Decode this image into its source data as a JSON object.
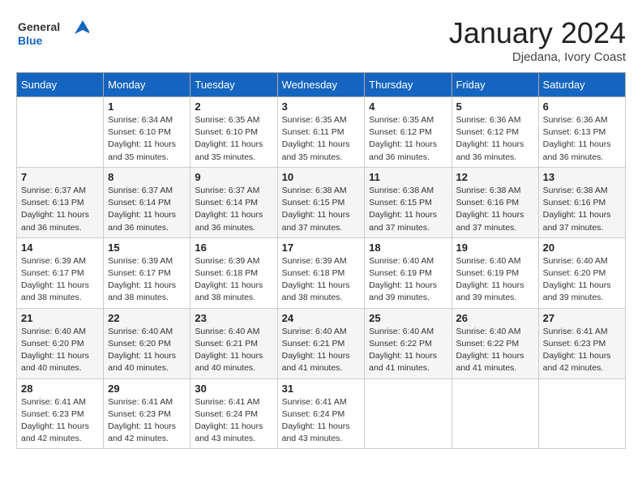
{
  "header": {
    "logo_general": "General",
    "logo_blue": "Blue",
    "month_year": "January 2024",
    "location": "Djedana, Ivory Coast"
  },
  "weekdays": [
    "Sunday",
    "Monday",
    "Tuesday",
    "Wednesday",
    "Thursday",
    "Friday",
    "Saturday"
  ],
  "weeks": [
    [
      {
        "day": "",
        "sunrise": "",
        "sunset": "",
        "daylight": ""
      },
      {
        "day": "1",
        "sunrise": "Sunrise: 6:34 AM",
        "sunset": "Sunset: 6:10 PM",
        "daylight": "Daylight: 11 hours and 35 minutes."
      },
      {
        "day": "2",
        "sunrise": "Sunrise: 6:35 AM",
        "sunset": "Sunset: 6:10 PM",
        "daylight": "Daylight: 11 hours and 35 minutes."
      },
      {
        "day": "3",
        "sunrise": "Sunrise: 6:35 AM",
        "sunset": "Sunset: 6:11 PM",
        "daylight": "Daylight: 11 hours and 35 minutes."
      },
      {
        "day": "4",
        "sunrise": "Sunrise: 6:35 AM",
        "sunset": "Sunset: 6:12 PM",
        "daylight": "Daylight: 11 hours and 36 minutes."
      },
      {
        "day": "5",
        "sunrise": "Sunrise: 6:36 AM",
        "sunset": "Sunset: 6:12 PM",
        "daylight": "Daylight: 11 hours and 36 minutes."
      },
      {
        "day": "6",
        "sunrise": "Sunrise: 6:36 AM",
        "sunset": "Sunset: 6:13 PM",
        "daylight": "Daylight: 11 hours and 36 minutes."
      }
    ],
    [
      {
        "day": "7",
        "sunrise": "Sunrise: 6:37 AM",
        "sunset": "Sunset: 6:13 PM",
        "daylight": "Daylight: 11 hours and 36 minutes."
      },
      {
        "day": "8",
        "sunrise": "Sunrise: 6:37 AM",
        "sunset": "Sunset: 6:14 PM",
        "daylight": "Daylight: 11 hours and 36 minutes."
      },
      {
        "day": "9",
        "sunrise": "Sunrise: 6:37 AM",
        "sunset": "Sunset: 6:14 PM",
        "daylight": "Daylight: 11 hours and 36 minutes."
      },
      {
        "day": "10",
        "sunrise": "Sunrise: 6:38 AM",
        "sunset": "Sunset: 6:15 PM",
        "daylight": "Daylight: 11 hours and 37 minutes."
      },
      {
        "day": "11",
        "sunrise": "Sunrise: 6:38 AM",
        "sunset": "Sunset: 6:15 PM",
        "daylight": "Daylight: 11 hours and 37 minutes."
      },
      {
        "day": "12",
        "sunrise": "Sunrise: 6:38 AM",
        "sunset": "Sunset: 6:16 PM",
        "daylight": "Daylight: 11 hours and 37 minutes."
      },
      {
        "day": "13",
        "sunrise": "Sunrise: 6:38 AM",
        "sunset": "Sunset: 6:16 PM",
        "daylight": "Daylight: 11 hours and 37 minutes."
      }
    ],
    [
      {
        "day": "14",
        "sunrise": "Sunrise: 6:39 AM",
        "sunset": "Sunset: 6:17 PM",
        "daylight": "Daylight: 11 hours and 38 minutes."
      },
      {
        "day": "15",
        "sunrise": "Sunrise: 6:39 AM",
        "sunset": "Sunset: 6:17 PM",
        "daylight": "Daylight: 11 hours and 38 minutes."
      },
      {
        "day": "16",
        "sunrise": "Sunrise: 6:39 AM",
        "sunset": "Sunset: 6:18 PM",
        "daylight": "Daylight: 11 hours and 38 minutes."
      },
      {
        "day": "17",
        "sunrise": "Sunrise: 6:39 AM",
        "sunset": "Sunset: 6:18 PM",
        "daylight": "Daylight: 11 hours and 38 minutes."
      },
      {
        "day": "18",
        "sunrise": "Sunrise: 6:40 AM",
        "sunset": "Sunset: 6:19 PM",
        "daylight": "Daylight: 11 hours and 39 minutes."
      },
      {
        "day": "19",
        "sunrise": "Sunrise: 6:40 AM",
        "sunset": "Sunset: 6:19 PM",
        "daylight": "Daylight: 11 hours and 39 minutes."
      },
      {
        "day": "20",
        "sunrise": "Sunrise: 6:40 AM",
        "sunset": "Sunset: 6:20 PM",
        "daylight": "Daylight: 11 hours and 39 minutes."
      }
    ],
    [
      {
        "day": "21",
        "sunrise": "Sunrise: 6:40 AM",
        "sunset": "Sunset: 6:20 PM",
        "daylight": "Daylight: 11 hours and 40 minutes."
      },
      {
        "day": "22",
        "sunrise": "Sunrise: 6:40 AM",
        "sunset": "Sunset: 6:20 PM",
        "daylight": "Daylight: 11 hours and 40 minutes."
      },
      {
        "day": "23",
        "sunrise": "Sunrise: 6:40 AM",
        "sunset": "Sunset: 6:21 PM",
        "daylight": "Daylight: 11 hours and 40 minutes."
      },
      {
        "day": "24",
        "sunrise": "Sunrise: 6:40 AM",
        "sunset": "Sunset: 6:21 PM",
        "daylight": "Daylight: 11 hours and 41 minutes."
      },
      {
        "day": "25",
        "sunrise": "Sunrise: 6:40 AM",
        "sunset": "Sunset: 6:22 PM",
        "daylight": "Daylight: 11 hours and 41 minutes."
      },
      {
        "day": "26",
        "sunrise": "Sunrise: 6:40 AM",
        "sunset": "Sunset: 6:22 PM",
        "daylight": "Daylight: 11 hours and 41 minutes."
      },
      {
        "day": "27",
        "sunrise": "Sunrise: 6:41 AM",
        "sunset": "Sunset: 6:23 PM",
        "daylight": "Daylight: 11 hours and 42 minutes."
      }
    ],
    [
      {
        "day": "28",
        "sunrise": "Sunrise: 6:41 AM",
        "sunset": "Sunset: 6:23 PM",
        "daylight": "Daylight: 11 hours and 42 minutes."
      },
      {
        "day": "29",
        "sunrise": "Sunrise: 6:41 AM",
        "sunset": "Sunset: 6:23 PM",
        "daylight": "Daylight: 11 hours and 42 minutes."
      },
      {
        "day": "30",
        "sunrise": "Sunrise: 6:41 AM",
        "sunset": "Sunset: 6:24 PM",
        "daylight": "Daylight: 11 hours and 43 minutes."
      },
      {
        "day": "31",
        "sunrise": "Sunrise: 6:41 AM",
        "sunset": "Sunset: 6:24 PM",
        "daylight": "Daylight: 11 hours and 43 minutes."
      },
      {
        "day": "",
        "sunrise": "",
        "sunset": "",
        "daylight": ""
      },
      {
        "day": "",
        "sunrise": "",
        "sunset": "",
        "daylight": ""
      },
      {
        "day": "",
        "sunrise": "",
        "sunset": "",
        "daylight": ""
      }
    ]
  ]
}
